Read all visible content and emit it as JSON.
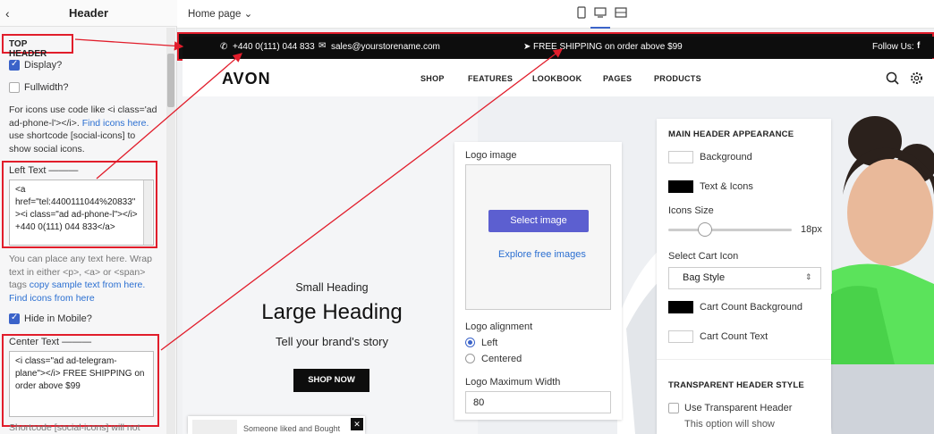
{
  "sidebar": {
    "back_icon": "chevron-left-icon",
    "title": "Header",
    "section_label": "TOP HEADER",
    "display_label": "Display?",
    "fullwidth_label": "Fullwidth?",
    "help1": [
      "For icons use code like <i class='ad",
      "ad-phone-l'></i>. ",
      "Find icons here.",
      "use shortcode [social-icons] to",
      "show social icons."
    ],
    "left_text_label": "Left Text ———",
    "left_text_value": [
      "<a",
      "href=\"tel:4400111044%20833\"",
      "><i class=\"ad ad-phone-l\"></i>",
      "+440 0(111) 044 833</a>"
    ],
    "help2": [
      "You can place any text here. Wrap",
      "text in either <p>, <a> or <span>",
      "tags ",
      "copy sample text from here.",
      "Find icons from here"
    ],
    "hide_mobile_label": "Hide in Mobile?",
    "center_text_label": "Center Text ———",
    "center_text_value": [
      "<i class=\"ad ad-telegram-",
      "plane\"></i> FREE SHIPPING on",
      "order above $99"
    ],
    "footer_note": "Shortcode [social-icons] will not"
  },
  "topbar": {
    "page_select": "Home page",
    "devices": [
      "tablet-icon",
      "desktop-icon",
      "fullwidth-icon"
    ]
  },
  "announcement": {
    "phone": "+440 0(111) 044 833",
    "email": "sales@yourstorename.com",
    "center": "FREE SHIPPING on order above $99",
    "follow": "Follow Us:"
  },
  "site_header": {
    "logo": "AVON",
    "nav": [
      "SHOP",
      "FEATURES",
      "LOOKBOOK",
      "PAGES",
      "PRODUCTS"
    ]
  },
  "hero": {
    "small_heading": "Small Heading",
    "large_heading": "Large Heading",
    "tagline": "Tell your brand's story",
    "button": "SHOP NOW"
  },
  "logo_panel": {
    "logo_image_label": "Logo image",
    "select_button": "Select image",
    "explore_link": "Explore free images",
    "alignment_label": "Logo alignment",
    "align_left": "Left",
    "align_center": "Centered",
    "max_width_label": "Logo Maximum Width",
    "max_width_value": "80"
  },
  "main_header_panel": {
    "title": "MAIN HEADER APPEARANCE",
    "background_label": "Background",
    "text_icons_label": "Text & Icons",
    "icons_size_label": "Icons Size",
    "icons_size_value": "18px",
    "icons_size_level": 0.3,
    "cart_icon_label": "Select Cart Icon",
    "cart_icon_value": "Bag Style",
    "cart_count_bg_label": "Cart Count Background",
    "cart_count_text_label": "Cart Count Text",
    "transparent_title": "TRANSPARENT HEADER STYLE",
    "use_transparent_label": "Use Transparent Header",
    "transparent_note": "This option will show"
  },
  "toast": {
    "text": "Someone liked and Bought"
  },
  "colors": {
    "accent": "#3b63c9",
    "annotation": "#e11d2b",
    "button": "#5c5fd0",
    "topbar_bg": "#0d0d0d"
  }
}
